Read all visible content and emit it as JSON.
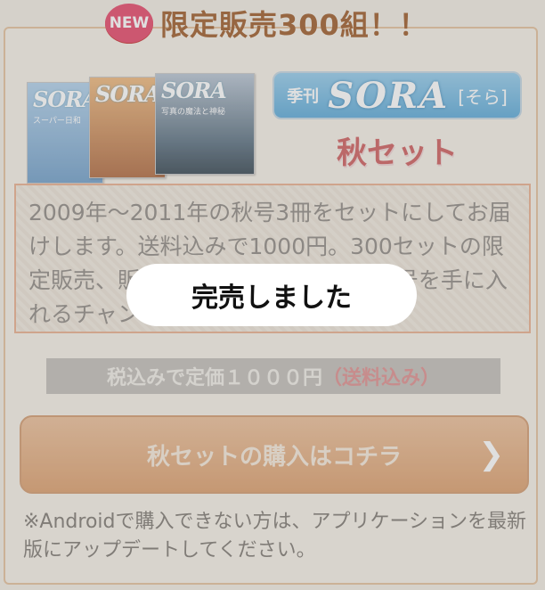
{
  "header": {
    "badge": "NEW",
    "title": "限定販売300組！！"
  },
  "product": {
    "magazines": [
      {
        "logo": "SORA",
        "subtitle": "スーパー日和"
      },
      {
        "logo": "SORA",
        "subtitle": ""
      },
      {
        "logo": "SORA",
        "subtitle": "写真の魔法と神秘"
      }
    ],
    "series_logo": {
      "prefix": "季刊",
      "name": "SORA",
      "reading": "[そら]"
    },
    "set_name": "秋セット"
  },
  "description": "2009年〜2011年の秋号3冊をセットにしてお届けします。送料込みで1000円。300セットの限定販売、販売が終了している2009年号を手に入れるチャンス!",
  "price": {
    "label": "税込みで定価１０００円",
    "note": "（送料込み）"
  },
  "buy_button": {
    "label": "秋セットの購入はコチラ",
    "icon": "chevron-right-icon"
  },
  "footnote": "※Androidで購入できない方は、アプリケーションを最新版にアップデートしてください。",
  "modal": {
    "message": "完売しました"
  },
  "colors": {
    "accent": "#e85a78",
    "button": "#e0a97c",
    "set_name": "#d36e6e"
  }
}
